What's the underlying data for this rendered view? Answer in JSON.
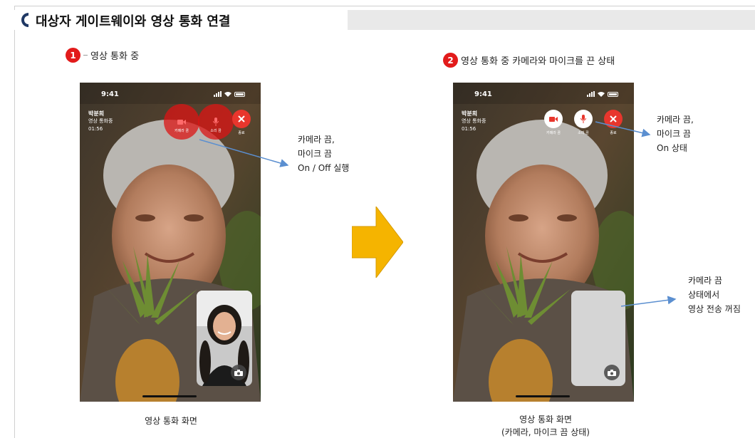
{
  "header": {
    "title": "대상자 게이트웨이와 영상 통화 연결"
  },
  "steps": [
    {
      "number": "1",
      "label": "영상 통화 중"
    },
    {
      "number": "2",
      "label": "영상 통화 중 카메라와 마이크를 끈 상태"
    }
  ],
  "phone1": {
    "time": "9:41",
    "caller_name": "박분희",
    "call_status": "영상 통화중",
    "duration": "01:56",
    "controls": {
      "camera_label": "카메라 끔",
      "mic_label": "소리 끔",
      "end_label": "종료"
    },
    "caption": "영상 통화 화면"
  },
  "phone2": {
    "time": "9:41",
    "caller_name": "박분희",
    "call_status": "영상 통화중",
    "duration": "01:56",
    "controls": {
      "camera_label": "카메라 끔",
      "mic_label": "소리 끔",
      "end_label": "종료"
    },
    "caption_line1": "영상 통화 화면",
    "caption_line2": "(카메라, 마이크 끔 상태)"
  },
  "annotations": {
    "toggle": [
      "카메라 끔,",
      "마이크 끔",
      "On / Off 실행"
    ],
    "on_state": [
      "카메라 끔,",
      "마이크 끔",
      "On 상태"
    ],
    "off_stream": [
      "카메라 끔",
      "상태에서",
      "영상 전송 꺼짐"
    ]
  },
  "colors": {
    "step_badge": "#e21b1b",
    "arrow": "#f5b400",
    "pointer_line": "#5b8fd0",
    "end_call": "#e8362d"
  }
}
